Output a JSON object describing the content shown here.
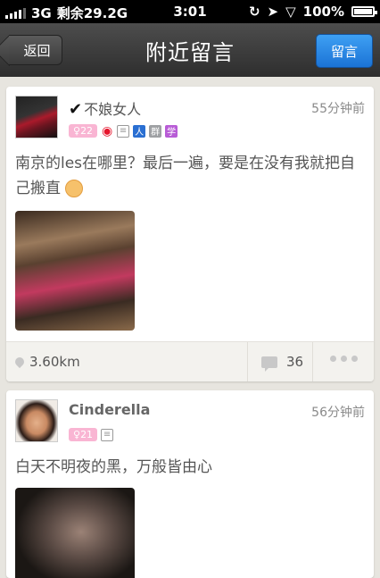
{
  "status_bar": {
    "carrier": "3G",
    "data_left": "剩余29.2G",
    "time": "3:01",
    "battery": "100%"
  },
  "nav": {
    "back_label": "返回",
    "title": "附近留言",
    "post_label": "留言"
  },
  "posts": [
    {
      "username": "不娘女人",
      "verified": true,
      "time": "55分钟前",
      "level": "22",
      "badges": [
        "weibo-icon",
        "doc-icon",
        "ren-icon",
        "qun-icon",
        "xue-icon"
      ],
      "badge_text": {
        "ren": "人",
        "qun": "群",
        "xue": "学"
      },
      "content": "南京的les在哪里？最后一遍，要是在没有我就把自己搬直",
      "distance": "3.60km",
      "comments": "36"
    },
    {
      "username": "Cinderella",
      "verified": false,
      "time": "56分钟前",
      "level": "21",
      "badges": [
        "doc-icon"
      ],
      "content": "白天不明夜的黑，万般皆由心"
    }
  ],
  "colors": {
    "nav_bg": "#3a3a3a",
    "post_button": "#2a8be6",
    "level_badge": "#f9b5d3",
    "background": "#e7e5df"
  }
}
